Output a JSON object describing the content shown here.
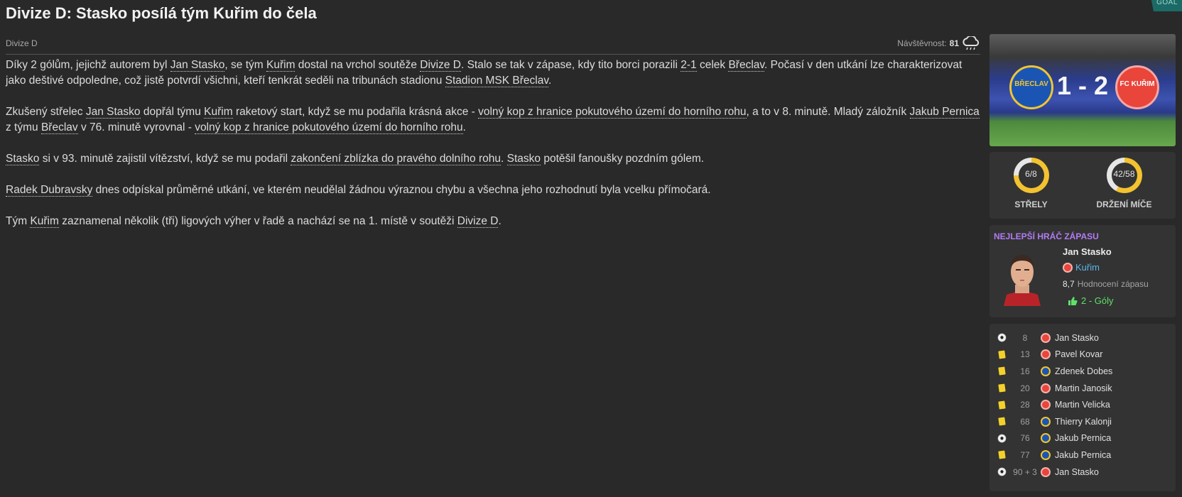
{
  "badge": "GOAL",
  "title": "Divize D: Stasko posílá tým Kuřim do čela",
  "competition": "Divize D",
  "attendance": {
    "label": "Návštěvnost:",
    "value": "81",
    "weather_icon": "rain-cloud-icon"
  },
  "article": {
    "p1": [
      {
        "t": "Díky 2 gólům, jejichž autorem byl "
      },
      {
        "t": "Jan Stasko",
        "link": true
      },
      {
        "t": ", se tým "
      },
      {
        "t": "Kuřim",
        "link": true
      },
      {
        "t": " dostal na vrchol soutěže "
      },
      {
        "t": "Divize D",
        "link": true
      },
      {
        "t": ". Stalo se tak v zápase, kdy tito borci porazili "
      },
      {
        "t": "2-1",
        "link": true
      },
      {
        "t": " celek "
      },
      {
        "t": "Břeclav",
        "link": true
      },
      {
        "t": ". Počasí v den utkání lze charakterizovat jako deštivé odpoledne, což jistě potvrdí všichni, kteří tenkrát seděli na tribunách stadionu "
      },
      {
        "t": "Stadion MSK Břeclav",
        "link": true
      },
      {
        "t": "."
      }
    ],
    "p2": [
      {
        "t": "Zkušený střelec "
      },
      {
        "t": "Jan Stasko",
        "link": true
      },
      {
        "t": " dopřál týmu "
      },
      {
        "t": "Kuřim",
        "link": true
      },
      {
        "t": " raketový start, když se mu podařila krásná akce - "
      },
      {
        "t": "volný kop z hranice pokutového území do horního rohu",
        "link": true
      },
      {
        "t": ", a to v 8. minutě. Mladý záložník "
      },
      {
        "t": "Jakub Pernica",
        "link": true
      },
      {
        "t": " z týmu "
      },
      {
        "t": "Břeclav",
        "link": true
      },
      {
        "t": " v 76. minutě vyrovnal - "
      },
      {
        "t": "volný kop z hranice pokutového území do horního rohu",
        "link": true
      },
      {
        "t": "."
      }
    ],
    "p3": [
      {
        "t": "Stasko",
        "link": true
      },
      {
        "t": " si v 93. minutě zajistil vítězství, když se mu podařil "
      },
      {
        "t": "zakončení zblízka do pravého dolního rohu",
        "link": true
      },
      {
        "t": ". "
      },
      {
        "t": "Stasko",
        "link": true
      },
      {
        "t": " potěšil fanoušky pozdním gólem."
      }
    ],
    "p4": [
      {
        "t": "Radek Dubravsky",
        "link": true
      },
      {
        "t": " dnes odpískal průměrné utkání, ve kterém neudělal žádnou výraznou chybu a všechna jeho rozhodnutí byla vcelku přímočará."
      }
    ],
    "p5": [
      {
        "t": "Tým "
      },
      {
        "t": "Kuřim",
        "link": true
      },
      {
        "t": " zaznamenal několik (tři) ligových výher v řadě a nachází se na 1. místě v soutěži "
      },
      {
        "t": "Divize D",
        "link": true
      },
      {
        "t": "."
      }
    ]
  },
  "scoreboard": {
    "score": "1 - 2",
    "home_crest_text": "BŘECLAV",
    "away_crest_text": "FC KUŘIM"
  },
  "stats": [
    {
      "value": "6/8",
      "label": "STŘELY",
      "fraction": 0.75
    },
    {
      "value": "42/58",
      "label": "DRŽENÍ MÍČE",
      "fraction": 0.58
    }
  ],
  "colors": {
    "accent_yellow": "#f3c230",
    "ring_track": "#e6e6e6",
    "purple": "#b27cf4",
    "goal_green": "#5fe06a",
    "team_blue": "#5ab6e8"
  },
  "best_player": {
    "heading": "NEJLEPŠÍ HRÁČ ZÁPASU",
    "name": "Jan Stasko",
    "team": "Kuřim",
    "rating_value": "8,7",
    "rating_label": "Hodnocení zápasu",
    "goals": "2 - Góly"
  },
  "events": [
    {
      "type": "goal",
      "minute": "8",
      "team": "away",
      "player": "Jan Stasko"
    },
    {
      "type": "yellow",
      "minute": "13",
      "team": "away",
      "player": "Pavel Kovar"
    },
    {
      "type": "yellow",
      "minute": "16",
      "team": "home",
      "player": "Zdenek Dobes"
    },
    {
      "type": "yellow",
      "minute": "20",
      "team": "away",
      "player": "Martin Janosik"
    },
    {
      "type": "yellow",
      "minute": "28",
      "team": "away",
      "player": "Martin Velicka"
    },
    {
      "type": "yellow",
      "minute": "68",
      "team": "home",
      "player": "Thierry Kalonji"
    },
    {
      "type": "goal",
      "minute": "76",
      "team": "home",
      "player": "Jakub Pernica"
    },
    {
      "type": "yellow",
      "minute": "77",
      "team": "home",
      "player": "Jakub Pernica"
    },
    {
      "type": "goal",
      "minute": "90 + 3",
      "team": "away",
      "player": "Jan Stasko"
    }
  ]
}
